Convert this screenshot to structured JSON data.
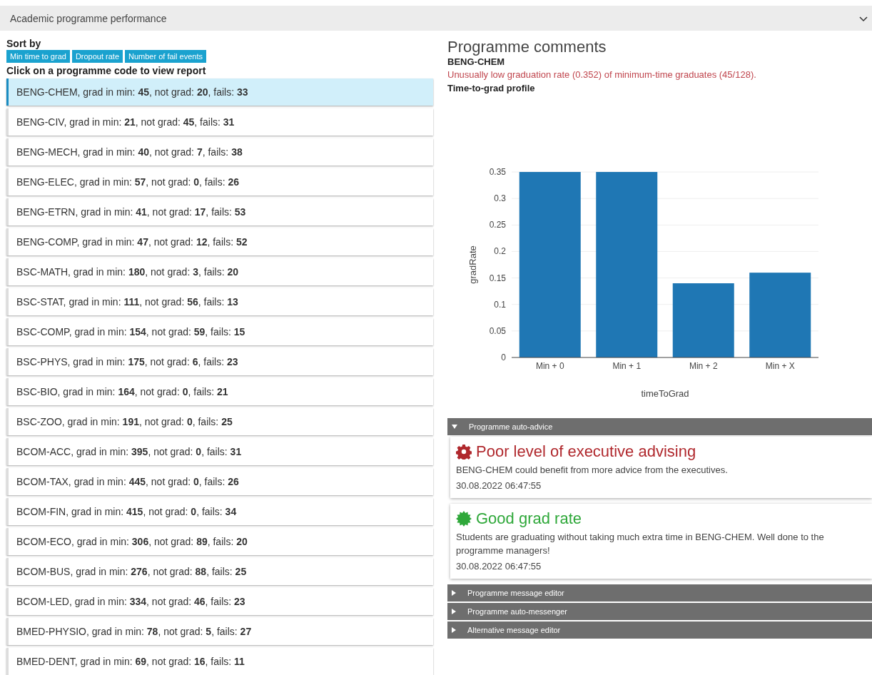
{
  "header": {
    "title": "Academic programme performance",
    "expanded": true
  },
  "sort": {
    "label": "Sort by",
    "buttons": [
      "Min time to grad",
      "Dropout rate",
      "Number of fail events"
    ]
  },
  "instruction": "Click on a programme code to view report",
  "programmes": [
    {
      "text": "BENG-CHEM, grad in min: **45**, not grad: **20**, fails: **33**",
      "selected": true
    },
    {
      "text": "BENG-CIV, grad in min: **21**, not grad: **45**, fails: **31**",
      "selected": false
    },
    {
      "text": "BENG-MECH, grad in min: **40**, not grad: **7**, fails: **38**",
      "selected": false
    },
    {
      "text": "BENG-ELEC, grad in min: **57**, not grad: **0**, fails: **26**",
      "selected": false
    },
    {
      "text": "BENG-ETRN, grad in min: **41**, not grad: **17**, fails: **53**",
      "selected": false
    },
    {
      "text": "BENG-COMP, grad in min: **47**, not grad: **12**, fails: **52**",
      "selected": false
    },
    {
      "text": "BSC-MATH, grad in min: **180**, not grad: **3**, fails: **20**",
      "selected": false
    },
    {
      "text": "BSC-STAT, grad in min: **111**, not grad: **56**, fails: **13**",
      "selected": false
    },
    {
      "text": "BSC-COMP, grad in min: **154**, not grad: **59**, fails: **15**",
      "selected": false
    },
    {
      "text": "BSC-PHYS, grad in min: **175**, not grad: **6**, fails: **23**",
      "selected": false
    },
    {
      "text": "BSC-BIO, grad in min: **164**, not grad: **0**, fails: **21**",
      "selected": false
    },
    {
      "text": "BSC-ZOO, grad in min: **191**, not grad: **0**, fails: **25**",
      "selected": false
    },
    {
      "text": "BCOM-ACC, grad in min: **395**, not grad: **0**, fails: **31**",
      "selected": false
    },
    {
      "text": "BCOM-TAX, grad in min: **445**, not grad: **0**, fails: **26**",
      "selected": false
    },
    {
      "text": "BCOM-FIN, grad in min: **415**, not grad: **0**, fails: **34**",
      "selected": false
    },
    {
      "text": "BCOM-ECO, grad in min: **306**, not grad: **89**, fails: **20**",
      "selected": false
    },
    {
      "text": "BCOM-BUS, grad in min: **276**, not grad: **88**, fails: **25**",
      "selected": false
    },
    {
      "text": "BCOM-LED, grad in min: **334**, not grad: **46**, fails: **23**",
      "selected": false
    },
    {
      "text": "BMED-PHYSIO, grad in min: **78**, not grad: **5**, fails: **27**",
      "selected": false
    },
    {
      "text": "BMED-DENT, grad in min: **69**, not grad: **16**, fails: **11**",
      "selected": false
    }
  ],
  "comments": {
    "title": "Programme comments",
    "code": "BENG-CHEM",
    "note": "Unusually low graduation rate (0.352) of minimum-time graduates (45/128).",
    "profile_title": "Time-to-grad profile",
    "chart_data": {
      "type": "bar",
      "xlabel": "timeToGrad",
      "ylabel": "gradRate",
      "categories": [
        "Min + 0",
        "Min + 1",
        "Min + 2",
        "Min + X"
      ],
      "series": [
        {
          "color": "#1f77b4",
          "values": [
            0.35,
            0.35,
            0.14,
            0.16
          ]
        }
      ],
      "grid": true,
      "ylim": [
        0,
        0.35
      ],
      "yticks": [
        0,
        0.05,
        0.1,
        0.15,
        0.2,
        0.25,
        0.3,
        0.35
      ]
    }
  },
  "panels": [
    {
      "title": "Programme auto-advice",
      "expanded": true,
      "items": [
        {
          "kind": "warning",
          "color": "#b0282d",
          "title": "Poor level of executive advising",
          "text": "BENG-CHEM could benefit from more advice from the executives.",
          "time": "30.08.2022 06:47:55"
        },
        {
          "kind": "good",
          "color": "#2fa83a",
          "title": "Good grad rate",
          "text": "Students are graduating without taking much extra time in BENG-CHEM. Well done to the programme managers!",
          "time": "30.08.2022 06:47:55"
        }
      ]
    },
    {
      "title": "Programme message editor",
      "expanded": false
    },
    {
      "title": "Programme auto-messenger",
      "expanded": false
    },
    {
      "title": "Alternative message editor",
      "expanded": false
    }
  ]
}
